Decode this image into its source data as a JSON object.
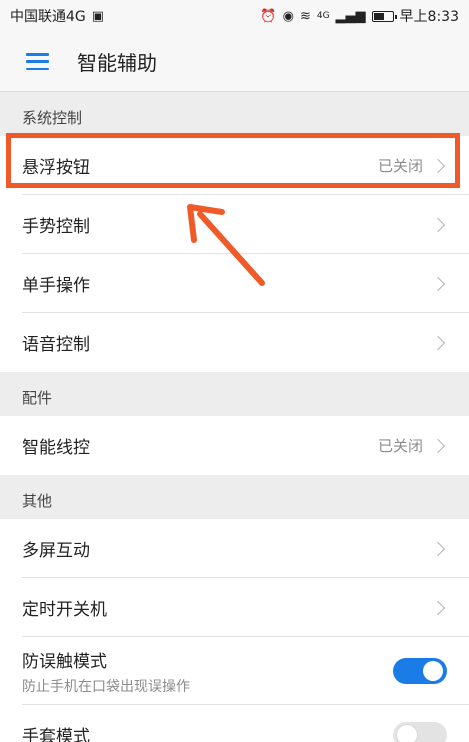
{
  "status_bar": {
    "carrier": "中国联通4G",
    "time": "早上8:33",
    "signal_label": "4G",
    "battery_level": 0.6
  },
  "app_bar": {
    "title": "智能辅助",
    "menu_icon": "hamburger-menu-icon"
  },
  "sections": {
    "system": {
      "header": "系统控制",
      "items": [
        {
          "label": "悬浮按钮",
          "value": "已关闭"
        },
        {
          "label": "手势控制",
          "value": ""
        },
        {
          "label": "单手操作",
          "value": ""
        },
        {
          "label": "语音控制",
          "value": ""
        }
      ]
    },
    "accessories": {
      "header": "配件",
      "items": [
        {
          "label": "智能线控",
          "value": "已关闭"
        }
      ]
    },
    "other": {
      "header": "其他",
      "items": [
        {
          "label": "多屏互动"
        },
        {
          "label": "定时开关机"
        },
        {
          "label": "防误触模式",
          "sub": "防止手机在口袋出现误操作",
          "toggle": true
        },
        {
          "label": "手套模式",
          "toggle": false
        }
      ]
    }
  },
  "annotation_color": "#f05a28",
  "accent_color": "#1b7ce8"
}
